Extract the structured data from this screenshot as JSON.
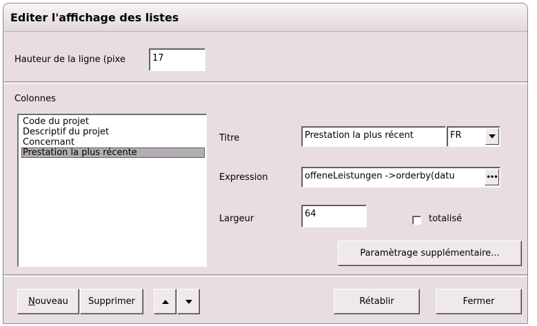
{
  "dialog": {
    "title": "Editer l'affichage des listes"
  },
  "row_height": {
    "label": "Hauteur de la ligne (pixe",
    "value": "17"
  },
  "columns": {
    "section_label": "Colonnes",
    "items": [
      "Code du projet",
      "Descriptif du projet",
      "Concernant",
      "Prestation la plus récente"
    ],
    "selected_index": 3
  },
  "details": {
    "titre_label": "Titre",
    "titre_value": "Prestation la plus récent",
    "language_value": "FR",
    "expression_label": "Expression",
    "expression_value": "offeneLeistungen ->orderby(datu",
    "largeur_label": "Largeur",
    "largeur_value": "64",
    "totalise_label": "totalisé",
    "totalise_checked": false,
    "extra_settings_label": "Paramètrage supplémentaire..."
  },
  "buttons": {
    "new_accel": "N",
    "new_rest": "ouveau",
    "delete": "Supprimer",
    "move_up_icon": "arrow-up-icon",
    "move_down_icon": "arrow-down-icon",
    "reset": "Rétablir",
    "close": "Fermer"
  }
}
